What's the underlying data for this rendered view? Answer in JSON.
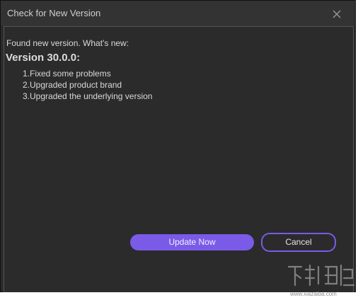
{
  "window": {
    "title": "Check for New Version"
  },
  "body": {
    "intro": "Found new version. What's new:",
    "version_heading": "Version 30.0.0:",
    "notes": [
      "1.Fixed some problems",
      "2.Upgraded product brand",
      "3.Upgraded the underlying version"
    ]
  },
  "buttons": {
    "update_label": "Update Now",
    "cancel_label": "Cancel"
  },
  "watermark": {
    "logo_text": "下载吧",
    "url": "www.xiazaiba.com"
  },
  "colors": {
    "background": "#2b2b2b",
    "titlebar": "#333333",
    "accent": "#7a5be8",
    "text": "#d8d8d8"
  },
  "icons": {
    "close": "close-icon"
  }
}
